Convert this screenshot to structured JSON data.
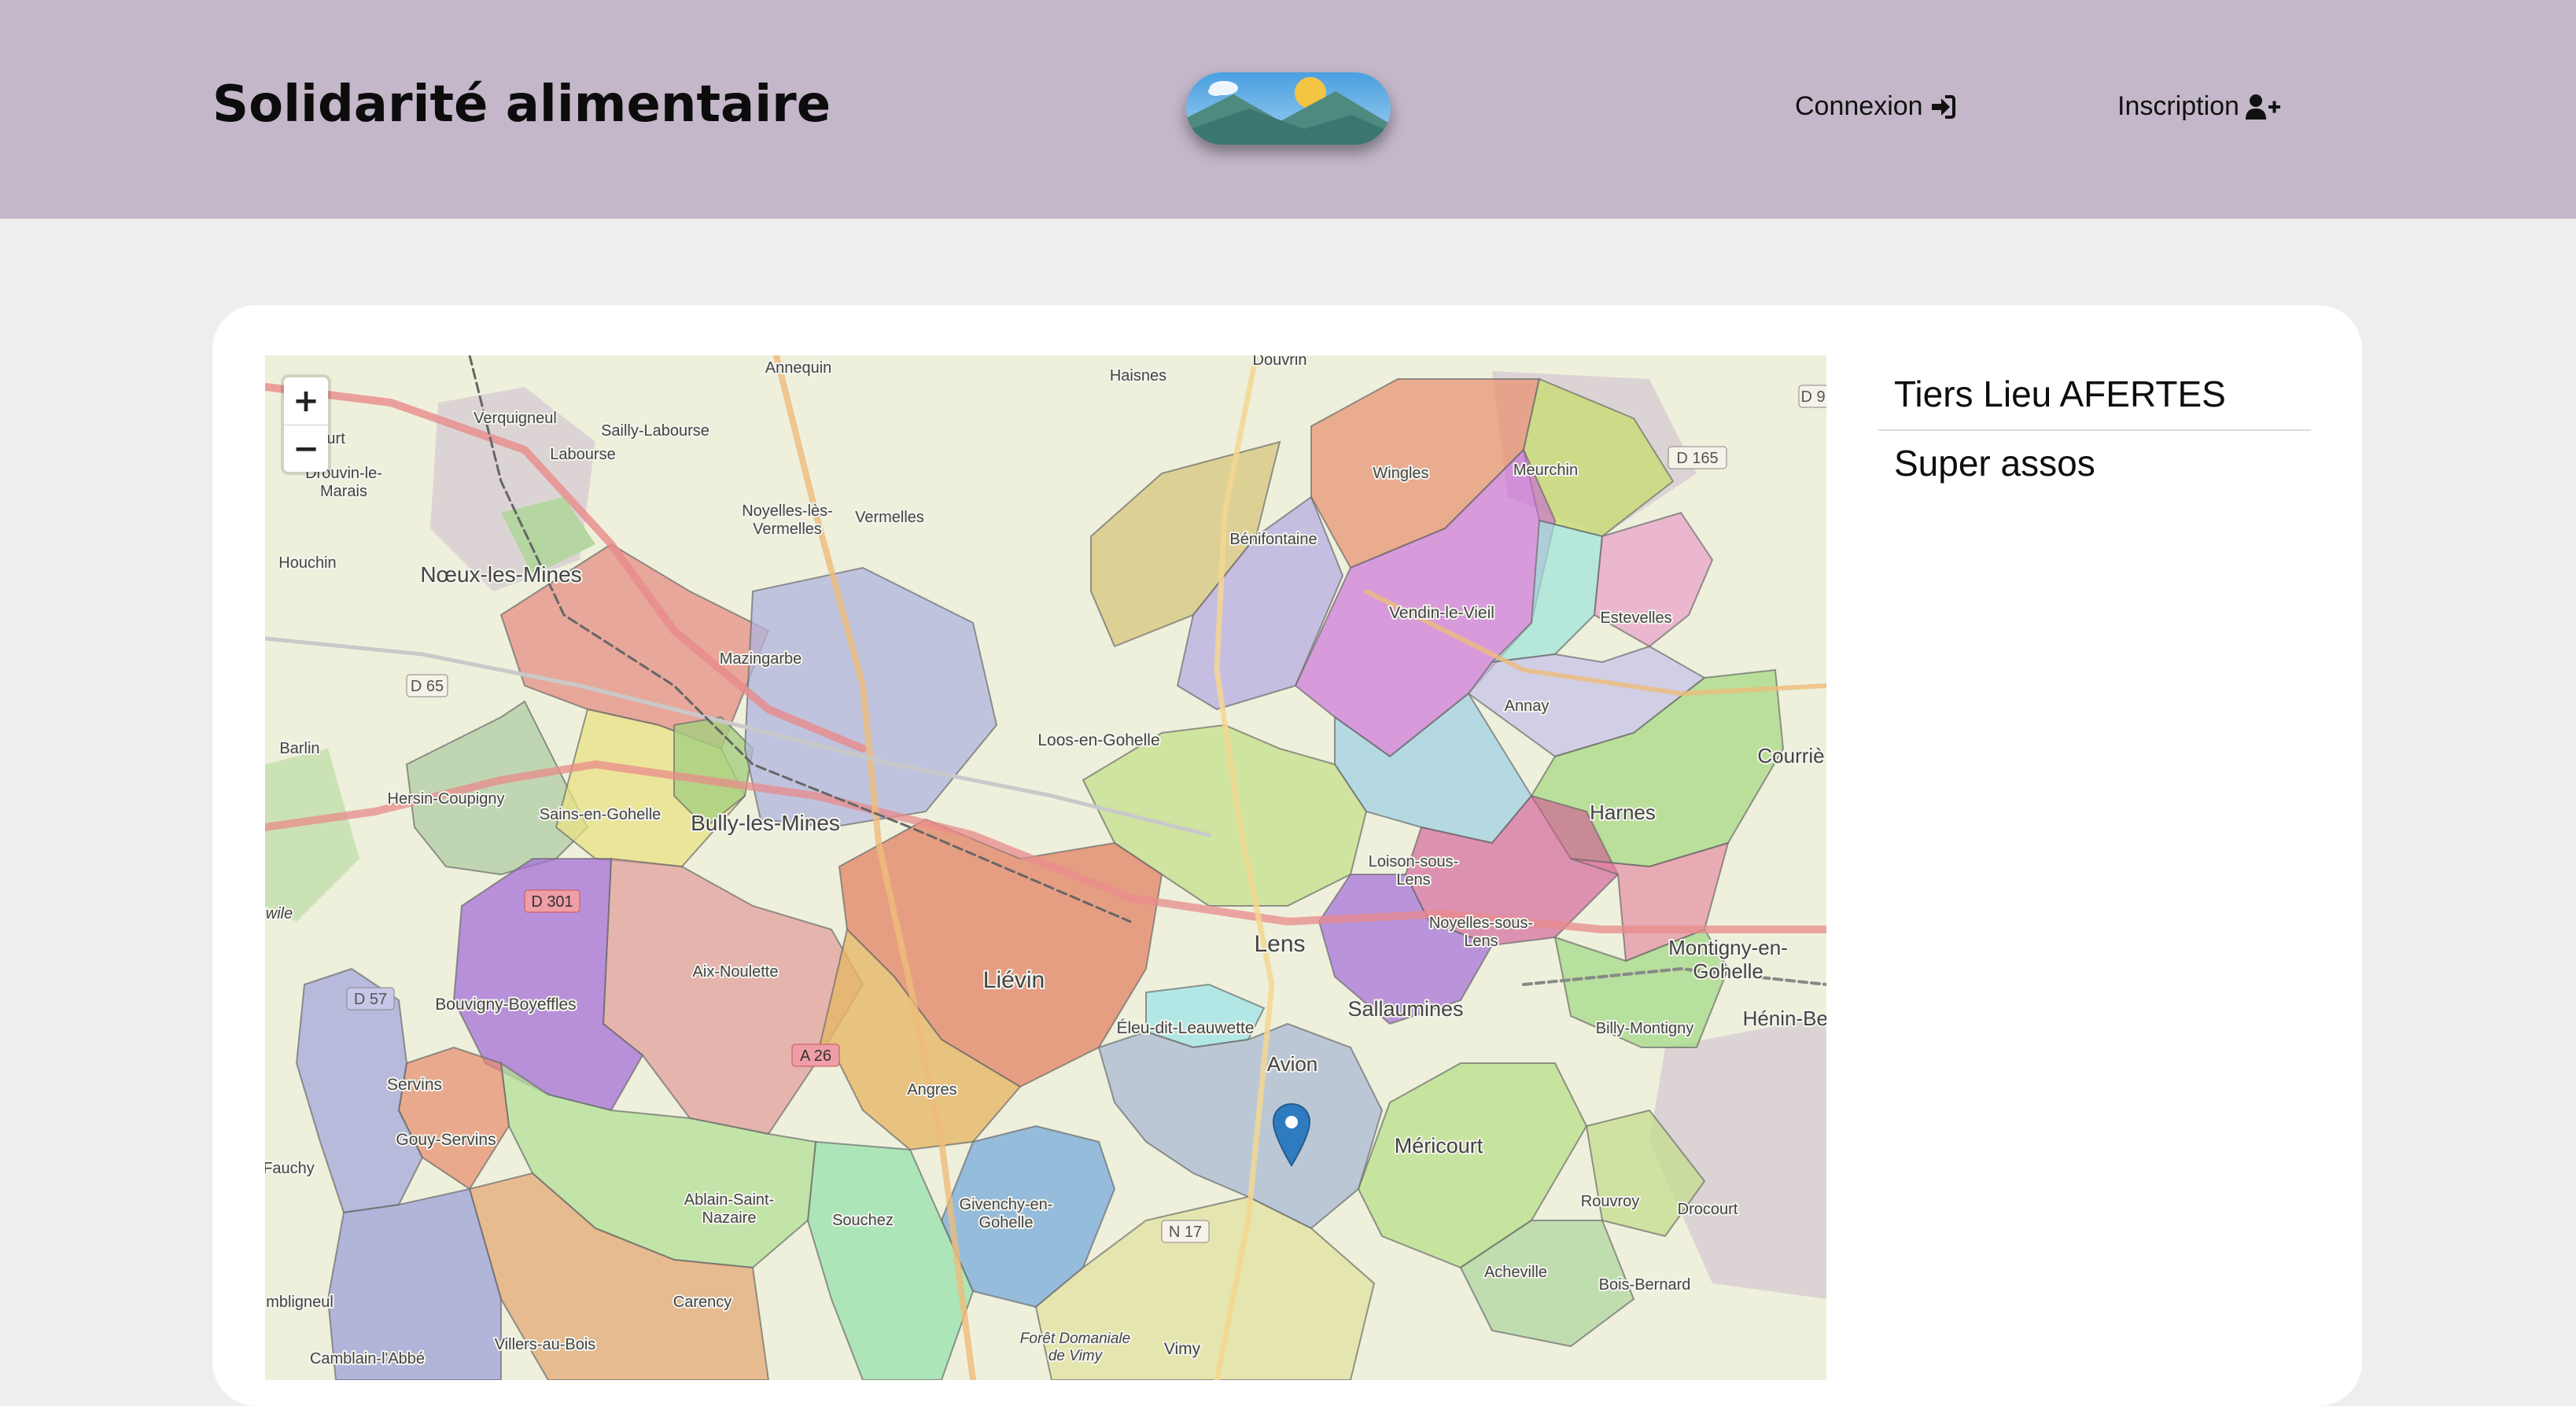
{
  "header": {
    "title": "Solidarité alimentaire",
    "logo_icon": "landscape-logo-icon",
    "nav": {
      "login_label": "Connexion",
      "login_icon": "sign-in-icon",
      "register_label": "Inscription",
      "register_icon": "user-plus-icon"
    },
    "background_color": "#c3b7c9"
  },
  "map": {
    "zoom_in_label": "+",
    "zoom_out_label": "−",
    "marker_icon": "map-marker-icon",
    "places": {
      "annequin": "Annequin",
      "haisnes": "Haisnes",
      "douvrin": "Douvrin",
      "verquigneul": "Verquigneul",
      "sailly": "Sailly-Labourse",
      "labourse": "Labourse",
      "vaudricourt": "ricourt",
      "drouvin": "Drouvin-le-\nMarais",
      "noyelles_vermelles": "Noyelles-lès-\nVermelles",
      "vermelles": "Vermelles",
      "wingles": "Wingles",
      "meurchin": "Meurchin",
      "benifontaine": "Bénifontaine",
      "houchin": "Houchin",
      "noeux": "Nœux-les-Mines",
      "mazingarbe": "Mazingarbe",
      "vendin": "Vendin-le-Vieil",
      "estevelles": "Estevelles",
      "annay": "Annay",
      "barlin": "Barlin",
      "loos": "Loos-en-Gohelle",
      "courrieres": "Courriè",
      "hersin": "Hersin-Coupigny",
      "sains": "Sains-en-Gohelle",
      "bully": "Bully-les-Mines",
      "harnes": "Harnes",
      "loison": "Loison-sous-\nLens",
      "noyelles_lens": "Noyelles-sous-\nLens",
      "montigny": "Montigny-en-\nGohelle",
      "lens": "Lens",
      "lievin": "Liévin",
      "aix": "Aix-Noulette",
      "bouvigny": "Bouvigny-Boyeffles",
      "sallaumines": "Sallaumines",
      "henin": "Hénin-Bea",
      "eleu": "Éleu-dit-Leauwette",
      "billy": "Billy-Montigny",
      "servins": "Servins",
      "angres": "Angres",
      "avion": "Avion",
      "gouy": "Gouy-Servins",
      "mericourt": "Méricourt",
      "ablain": "Ablain-Saint-\nNazaire",
      "souchez": "Souchez",
      "givenchy": "Givenchy-en-\nGohelle",
      "rouvroy": "Rouvroy",
      "drocourt": "Drocourt",
      "acheville": "Acheville",
      "bois_bernard": "Bois-Bernard",
      "carency": "Carency",
      "vimy": "Vimy",
      "foret": "Forêt Domaniale\nde Vimy",
      "villers": "Villers-au-Bois",
      "camblain": "Camblain-l'Abbé",
      "ambligneul": "mbligneul",
      "fauchy": "Fauchy",
      "wile": "wile"
    },
    "roads": {
      "d65": "D 65",
      "d301": "D 301",
      "d57": "D 57",
      "a26": "A 26",
      "n17": "N 17",
      "d165": "D 165",
      "d9": "D 9"
    }
  },
  "associations": [
    {
      "name": "Tiers Lieu AFERTES"
    },
    {
      "name": "Super assos"
    }
  ]
}
